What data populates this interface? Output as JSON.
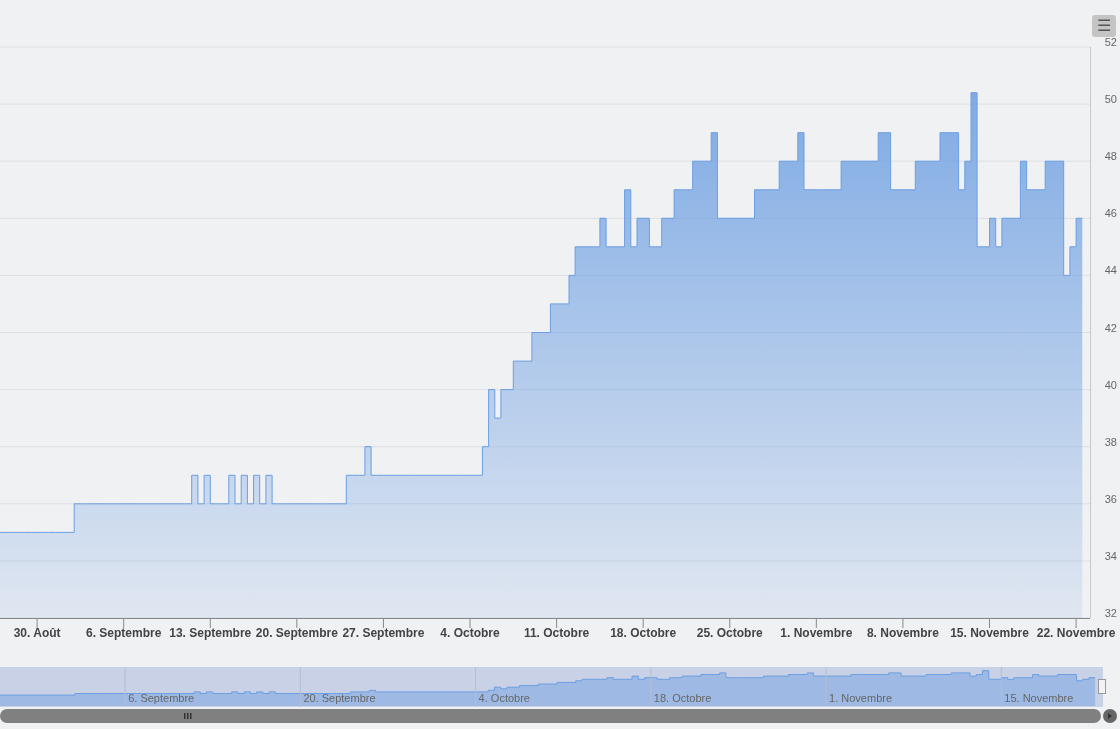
{
  "chart": {
    "chart_data": {
      "type": "area",
      "grid": true,
      "ylim": [
        32,
        52
      ],
      "categories": [
        null,
        null,
        null,
        null,
        null,
        null,
        "30. Août",
        null,
        null,
        null,
        null,
        null,
        null,
        null,
        null,
        null,
        null,
        null,
        null,
        null,
        "6. Septembre",
        null,
        null,
        null,
        null,
        null,
        null,
        null,
        null,
        null,
        null,
        null,
        null,
        null,
        "13. Septembre",
        null,
        null,
        null,
        null,
        null,
        null,
        null,
        null,
        null,
        null,
        null,
        null,
        null,
        "20. Septembre",
        null,
        null,
        null,
        null,
        null,
        null,
        null,
        null,
        null,
        null,
        null,
        null,
        null,
        "27. Septembre",
        null,
        null,
        null,
        null,
        null,
        null,
        null,
        null,
        null,
        null,
        null,
        null,
        null,
        "4. Octobre",
        null,
        null,
        null,
        null,
        null,
        null,
        null,
        null,
        null,
        null,
        null,
        null,
        null,
        "11. Octobre",
        null,
        null,
        null,
        null,
        null,
        null,
        null,
        null,
        null,
        null,
        null,
        null,
        null,
        "18. Octobre",
        null,
        null,
        null,
        null,
        null,
        null,
        null,
        null,
        null,
        null,
        null,
        null,
        null,
        "25. Octobre",
        null,
        null,
        null,
        null,
        null,
        null,
        null,
        null,
        null,
        null,
        null,
        null,
        null,
        "1. Novembre",
        null,
        null,
        null,
        null,
        null,
        null,
        null,
        null,
        null,
        null,
        null,
        null,
        null,
        "8. Novembre",
        null,
        null,
        null,
        null,
        null,
        null,
        null,
        null,
        null,
        null,
        null,
        null,
        null,
        "15. Novembre",
        null,
        null,
        null,
        null,
        null,
        null,
        null,
        null,
        null,
        null,
        null,
        null,
        null,
        "22. Novembre",
        null
      ],
      "yticks": [
        32,
        34,
        36,
        38,
        40,
        42,
        44,
        46,
        48,
        50,
        52
      ],
      "series": [
        {
          "color": "#6b9ee2",
          "values": [
            35,
            35,
            35,
            35,
            35,
            35,
            35,
            35,
            35,
            35,
            35,
            35,
            36,
            36,
            36,
            36,
            36,
            36,
            36,
            36,
            36,
            36,
            36,
            36,
            36,
            36,
            36,
            36,
            36,
            36,
            36,
            37,
            36,
            37,
            36,
            36,
            36,
            37,
            36,
            37,
            36,
            37,
            36,
            37,
            36,
            36,
            36,
            36,
            36,
            36,
            36,
            36,
            36,
            36,
            36,
            36,
            37,
            37,
            37,
            38,
            37,
            37,
            37,
            37,
            37,
            37,
            37,
            37,
            37,
            37,
            37,
            37,
            37,
            37,
            37,
            37,
            37,
            37,
            38,
            40,
            39,
            40,
            40,
            41,
            41,
            41,
            42,
            42,
            42,
            43,
            43,
            43,
            44,
            45,
            45,
            45,
            45,
            46,
            45,
            45,
            45,
            47,
            45,
            46,
            46,
            45,
            45,
            46,
            46,
            47,
            47,
            47,
            48,
            48,
            48,
            49,
            46,
            46,
            46,
            46,
            46,
            46,
            47,
            47,
            47,
            47,
            48,
            48,
            48,
            49,
            47,
            47,
            47,
            47,
            47,
            47,
            48,
            48,
            48,
            48,
            48,
            48,
            49,
            49,
            47,
            47,
            47,
            47,
            48,
            48,
            48,
            48,
            49,
            49,
            49,
            47,
            48,
            50.4,
            45,
            45,
            46,
            45,
            46,
            46,
            46,
            48,
            47,
            47,
            47,
            48,
            48,
            48,
            44,
            45,
            46,
            46
          ]
        }
      ]
    }
  },
  "navigator": {
    "labels": [
      "6. Septembre",
      "20. Septembre",
      "4. Octobre",
      "18. Octobre",
      "1. Novembre",
      "15. Novembre"
    ]
  },
  "menu_button": {
    "label": "☰"
  }
}
